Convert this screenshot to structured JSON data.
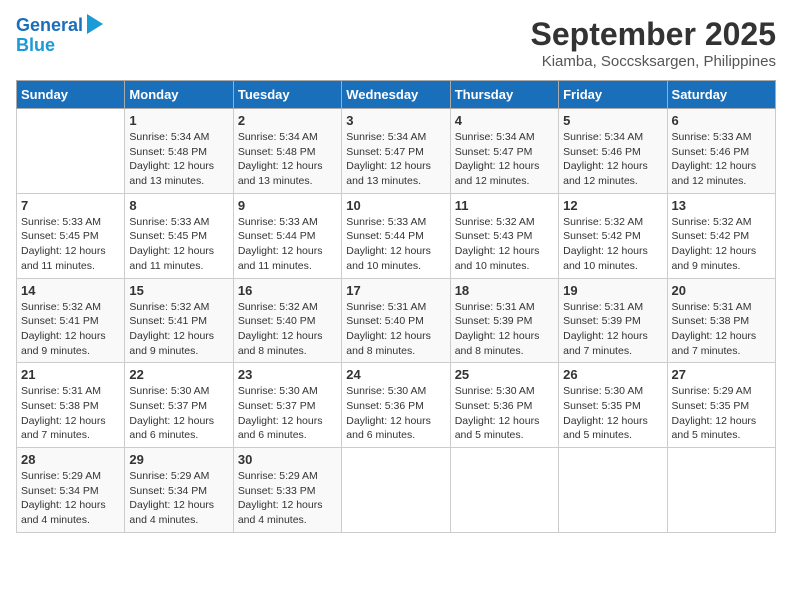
{
  "header": {
    "logo_line1": "General",
    "logo_line2": "Blue",
    "month_title": "September 2025",
    "location": "Kiamba, Soccsksargen, Philippines"
  },
  "days_of_week": [
    "Sunday",
    "Monday",
    "Tuesday",
    "Wednesday",
    "Thursday",
    "Friday",
    "Saturday"
  ],
  "weeks": [
    [
      {
        "num": "",
        "detail": ""
      },
      {
        "num": "1",
        "detail": "Sunrise: 5:34 AM\nSunset: 5:48 PM\nDaylight: 12 hours\nand 13 minutes."
      },
      {
        "num": "2",
        "detail": "Sunrise: 5:34 AM\nSunset: 5:48 PM\nDaylight: 12 hours\nand 13 minutes."
      },
      {
        "num": "3",
        "detail": "Sunrise: 5:34 AM\nSunset: 5:47 PM\nDaylight: 12 hours\nand 13 minutes."
      },
      {
        "num": "4",
        "detail": "Sunrise: 5:34 AM\nSunset: 5:47 PM\nDaylight: 12 hours\nand 12 minutes."
      },
      {
        "num": "5",
        "detail": "Sunrise: 5:34 AM\nSunset: 5:46 PM\nDaylight: 12 hours\nand 12 minutes."
      },
      {
        "num": "6",
        "detail": "Sunrise: 5:33 AM\nSunset: 5:46 PM\nDaylight: 12 hours\nand 12 minutes."
      }
    ],
    [
      {
        "num": "7",
        "detail": "Sunrise: 5:33 AM\nSunset: 5:45 PM\nDaylight: 12 hours\nand 11 minutes."
      },
      {
        "num": "8",
        "detail": "Sunrise: 5:33 AM\nSunset: 5:45 PM\nDaylight: 12 hours\nand 11 minutes."
      },
      {
        "num": "9",
        "detail": "Sunrise: 5:33 AM\nSunset: 5:44 PM\nDaylight: 12 hours\nand 11 minutes."
      },
      {
        "num": "10",
        "detail": "Sunrise: 5:33 AM\nSunset: 5:44 PM\nDaylight: 12 hours\nand 10 minutes."
      },
      {
        "num": "11",
        "detail": "Sunrise: 5:32 AM\nSunset: 5:43 PM\nDaylight: 12 hours\nand 10 minutes."
      },
      {
        "num": "12",
        "detail": "Sunrise: 5:32 AM\nSunset: 5:42 PM\nDaylight: 12 hours\nand 10 minutes."
      },
      {
        "num": "13",
        "detail": "Sunrise: 5:32 AM\nSunset: 5:42 PM\nDaylight: 12 hours\nand 9 minutes."
      }
    ],
    [
      {
        "num": "14",
        "detail": "Sunrise: 5:32 AM\nSunset: 5:41 PM\nDaylight: 12 hours\nand 9 minutes."
      },
      {
        "num": "15",
        "detail": "Sunrise: 5:32 AM\nSunset: 5:41 PM\nDaylight: 12 hours\nand 9 minutes."
      },
      {
        "num": "16",
        "detail": "Sunrise: 5:32 AM\nSunset: 5:40 PM\nDaylight: 12 hours\nand 8 minutes."
      },
      {
        "num": "17",
        "detail": "Sunrise: 5:31 AM\nSunset: 5:40 PM\nDaylight: 12 hours\nand 8 minutes."
      },
      {
        "num": "18",
        "detail": "Sunrise: 5:31 AM\nSunset: 5:39 PM\nDaylight: 12 hours\nand 8 minutes."
      },
      {
        "num": "19",
        "detail": "Sunrise: 5:31 AM\nSunset: 5:39 PM\nDaylight: 12 hours\nand 7 minutes."
      },
      {
        "num": "20",
        "detail": "Sunrise: 5:31 AM\nSunset: 5:38 PM\nDaylight: 12 hours\nand 7 minutes."
      }
    ],
    [
      {
        "num": "21",
        "detail": "Sunrise: 5:31 AM\nSunset: 5:38 PM\nDaylight: 12 hours\nand 7 minutes."
      },
      {
        "num": "22",
        "detail": "Sunrise: 5:30 AM\nSunset: 5:37 PM\nDaylight: 12 hours\nand 6 minutes."
      },
      {
        "num": "23",
        "detail": "Sunrise: 5:30 AM\nSunset: 5:37 PM\nDaylight: 12 hours\nand 6 minutes."
      },
      {
        "num": "24",
        "detail": "Sunrise: 5:30 AM\nSunset: 5:36 PM\nDaylight: 12 hours\nand 6 minutes."
      },
      {
        "num": "25",
        "detail": "Sunrise: 5:30 AM\nSunset: 5:36 PM\nDaylight: 12 hours\nand 5 minutes."
      },
      {
        "num": "26",
        "detail": "Sunrise: 5:30 AM\nSunset: 5:35 PM\nDaylight: 12 hours\nand 5 minutes."
      },
      {
        "num": "27",
        "detail": "Sunrise: 5:29 AM\nSunset: 5:35 PM\nDaylight: 12 hours\nand 5 minutes."
      }
    ],
    [
      {
        "num": "28",
        "detail": "Sunrise: 5:29 AM\nSunset: 5:34 PM\nDaylight: 12 hours\nand 4 minutes."
      },
      {
        "num": "29",
        "detail": "Sunrise: 5:29 AM\nSunset: 5:34 PM\nDaylight: 12 hours\nand 4 minutes."
      },
      {
        "num": "30",
        "detail": "Sunrise: 5:29 AM\nSunset: 5:33 PM\nDaylight: 12 hours\nand 4 minutes."
      },
      {
        "num": "",
        "detail": ""
      },
      {
        "num": "",
        "detail": ""
      },
      {
        "num": "",
        "detail": ""
      },
      {
        "num": "",
        "detail": ""
      }
    ]
  ]
}
